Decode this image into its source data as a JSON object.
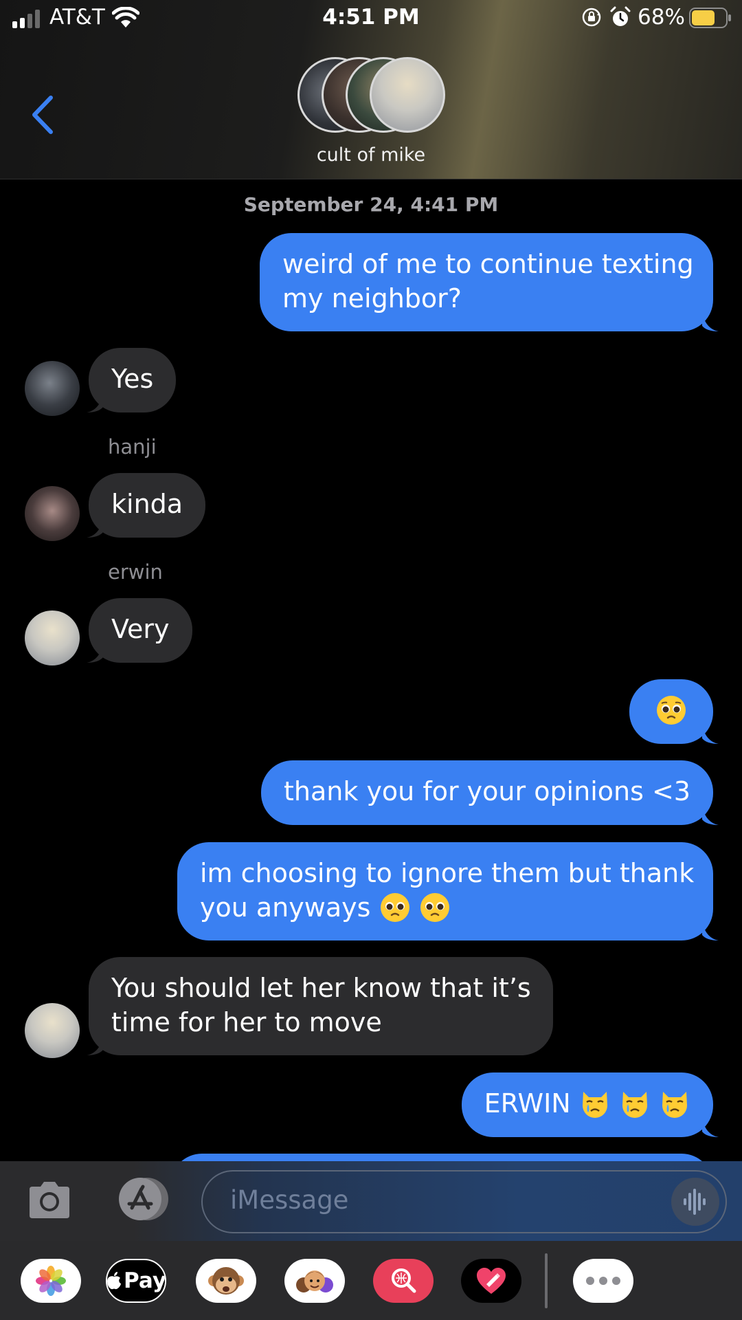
{
  "status_bar": {
    "carrier": "AT&T",
    "time": "4:51 PM",
    "battery_percent": "68%",
    "battery_level": 0.68,
    "signal_bars": 2
  },
  "header": {
    "group_name": "cult of mike",
    "back_icon": "chevron-left-icon"
  },
  "conversation": {
    "timestamp": "September 24, 4:41 PM",
    "messages": [
      {
        "type": "sent",
        "text": "weird of me to continue texting\nmy neighbor?"
      },
      {
        "type": "received",
        "sender": "",
        "text": "Yes"
      },
      {
        "type": "received",
        "sender": "hanji",
        "text": "kinda"
      },
      {
        "type": "received",
        "sender": "erwin",
        "text": "Very"
      },
      {
        "type": "sent",
        "text": "🥺"
      },
      {
        "type": "sent",
        "text": "thank you for your opinions <3"
      },
      {
        "type": "sent",
        "text": "im choosing to ignore them but thank\nyou anyways 🥺 🥺"
      },
      {
        "type": "received",
        "sender": "",
        "text": "You should let her know that it’s\ntime for her to move"
      },
      {
        "type": "sent",
        "text": "ERWIN 😿 😿 😿"
      }
    ],
    "m1_line1": "weird of me to continue texting",
    "m1_line2": "my neighbor?",
    "m2": "Yes",
    "sender_hanji": "hanji",
    "m3": "kinda",
    "sender_erwin": "erwin",
    "m4": "Very",
    "m6": "thank you for your opinions <3",
    "m7_line1": "im choosing to ignore them but thank",
    "m7_line2": "you anyways",
    "m8_line1": "You should let her know that it’s",
    "m8_line2": "time for her to move",
    "m9": "ERWIN"
  },
  "input": {
    "placeholder": "iMessage"
  },
  "app_drawer": {
    "apps": [
      "photos-icon",
      "apple-pay-icon",
      "animoji-icon",
      "memoji-icon",
      "image-search-icon",
      "digital-touch-icon",
      "more-icon"
    ],
    "apple_pay_label": "Pay"
  },
  "colors": {
    "sent_bubble": "#3a80f2",
    "received_bubble": "#2c2c2e",
    "accent": "#3a80f2",
    "battery": "#f7ce46"
  }
}
